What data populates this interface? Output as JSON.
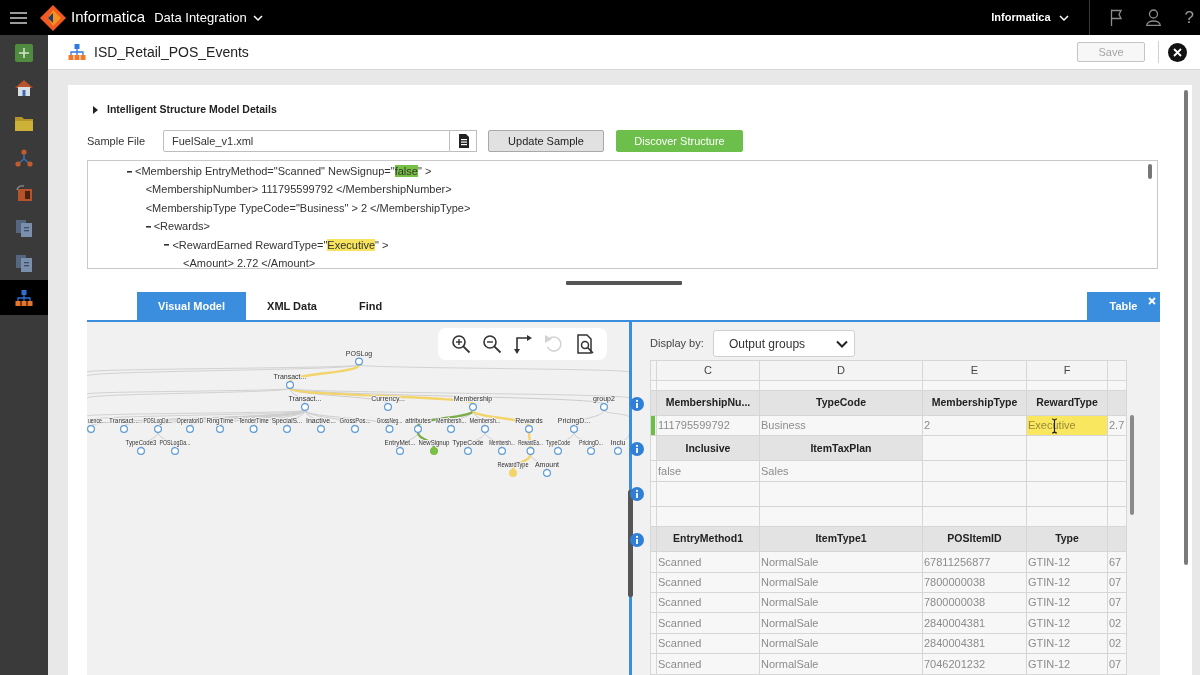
{
  "top_bar": {
    "brand": "Informatica",
    "app": "Data Integration",
    "org": "Informatica",
    "help": "?"
  },
  "sidebar": {
    "items": [
      {
        "kind": "new",
        "selected": false
      },
      {
        "kind": "home",
        "selected": false
      },
      {
        "kind": "folder",
        "selected": false
      },
      {
        "kind": "network",
        "selected": false
      },
      {
        "kind": "package",
        "selected": false
      },
      {
        "kind": "document",
        "selected": false
      },
      {
        "kind": "document",
        "selected": false
      },
      {
        "kind": "structure",
        "selected": true
      }
    ]
  },
  "header": {
    "title": "ISD_Retail_POS_Events",
    "save": {
      "label": "Save",
      "disabled": true
    }
  },
  "details": {
    "label": "Intelligent Structure Model Details",
    "expanded": false
  },
  "sample": {
    "label": "Sample File",
    "value": "FuelSale_v1.xml",
    "buttons": [
      {
        "label": "Update Sample",
        "kind": "secondary"
      },
      {
        "label": "Discover Structure",
        "kind": "primary"
      }
    ]
  },
  "xml": [
    {
      "segments": [
        {
          "text": "<Membership EntryMethod=\"Scanned\" NewSignup=\""
        },
        {
          "text": "false",
          "color": "#76c043"
        },
        {
          "text": "\" >"
        }
      ],
      "expanded": true,
      "children": [
        {
          "segments": [
            {
              "text": "<MembershipNumber> 111795599792 </MembershipNumber>"
            }
          ]
        },
        {
          "segments": [
            {
              "text": "<MembershipType TypeCode=\"Business\" > 2 </MembershipType>"
            }
          ]
        },
        {
          "segments": [
            {
              "text": "<Rewards>"
            }
          ],
          "expanded": true,
          "children": [
            {
              "segments": [
                {
                  "text": "<RewardEarned RewardType=\""
                },
                {
                  "text": "Executive",
                  "color": "#f7e35c"
                },
                {
                  "text": "\" >"
                }
              ],
              "expanded": true,
              "children": [
                {
                  "segments": [
                    {
                      "text": "<Amount> 2.72 </Amount>"
                    }
                  ]
                }
              ]
            }
          ]
        }
      ]
    }
  ],
  "tabs": [
    {
      "label": "Visual Model",
      "selected": true
    },
    {
      "label": "XML Data",
      "selected": false
    },
    {
      "label": "Find",
      "selected": false
    }
  ],
  "side_tab": {
    "label": "Table",
    "selected": true
  },
  "visual_model": {
    "toolbar": [
      {
        "kind": "zoom_in",
        "disabled": false
      },
      {
        "kind": "zoom_out",
        "disabled": false
      },
      {
        "kind": "layout",
        "disabled": false
      },
      {
        "kind": "undo",
        "disabled": true
      },
      {
        "kind": "fit",
        "disabled": false
      }
    ],
    "tree": [
      {
        "label": "POSLog",
        "children": [
          {
            "label": "Transact...",
            "link": {
              "color": "#f2d46b"
            },
            "children": [
              {
                "label": "Transact...",
                "children": [
                  {
                    "label": "uence..."
                  },
                  {
                    "label": "Transact..."
                  },
                  {
                    "label": "POSLogDa...",
                    "children": [
                      {
                        "label": "TypeCode3"
                      },
                      {
                        "label": "POSLogDa..."
                      }
                    ]
                  },
                  {
                    "label": "OperatorID"
                  },
                  {
                    "label": "RingTime"
                  },
                  {
                    "label": "TenderTime"
                  },
                  {
                    "label": "SpecialS..."
                  },
                  {
                    "label": "Inactive..."
                  },
                  {
                    "label": "GrossPos..."
                  },
                  {
                    "label": "GrossNeg..."
                  }
                ]
              },
              {
                "label": "Currency..."
              },
              {
                "label": "Membership",
                "link": {
                  "color": "#f2d46b"
                },
                "children": [
                  {
                    "label": "attributes",
                    "link": {
                      "color": "#79ad4a"
                    },
                    "children": [
                      {
                        "label": "EntryMet..."
                      },
                      {
                        "label": "NewSignup",
                        "link": {
                          "color": "#79ad4a"
                        },
                        "color": "#79c043"
                      }
                    ]
                  },
                  {
                    "label": "Membersh..."
                  },
                  {
                    "label": "Membersh...",
                    "children": [
                      {
                        "label": "TypeCode"
                      },
                      {
                        "label": "Membersh..."
                      }
                    ]
                  },
                  {
                    "label": "Rewards",
                    "link": {
                      "color": "#f2d46b"
                    },
                    "children": [
                      {
                        "label": "RewardEa...",
                        "link": {
                          "color": "#f2d46b"
                        },
                        "children": [
                          {
                            "label": "RewardType",
                            "link": {
                              "color": "#f2d46b"
                            },
                            "color": "#f2d46b"
                          },
                          {
                            "label": "Amount"
                          }
                        ]
                      }
                    ]
                  }
                ]
              },
              {
                "label": "group2",
                "children": [
                  {
                    "label": "PricingD...",
                    "children": [
                      {
                        "label": "TypeCode"
                      },
                      {
                        "label": "PricingD..."
                      }
                    ]
                  }
                ]
              }
            ]
          }
        ]
      },
      {
        "label": "Inclu"
      }
    ]
  },
  "table": {
    "display_by": {
      "label": "Display by:",
      "value": "Output groups"
    },
    "columns": [
      "C",
      "D",
      "E",
      "F"
    ],
    "rows": [
      {
        "kind": "gap"
      },
      {
        "kind": "group",
        "cells": [
          "MembershipNu...",
          "TypeCode",
          "MembershipType",
          "RewardType"
        ]
      },
      {
        "kind": "data",
        "selected": true,
        "cells": [
          "111795599792",
          "Business",
          "2",
          {
            "text": "Executive",
            "color": "#f9e75f",
            "cursor": true
          },
          "2.7"
        ]
      },
      {
        "kind": "group",
        "cells": [
          "Inclusive",
          "ItemTaxPlan"
        ]
      },
      {
        "kind": "data",
        "selected": false,
        "cells": [
          "false",
          "Sales"
        ]
      },
      {
        "kind": "group"
      },
      {
        "kind": "data",
        "selected": false
      },
      {
        "kind": "group",
        "cells": [
          "EntryMethod1",
          "ItemType1",
          "POSItemID",
          "Type"
        ]
      },
      {
        "kind": "data",
        "selected": false,
        "cells": [
          "Scanned",
          "NormalSale",
          "67811256877",
          "GTIN-12",
          "67"
        ]
      },
      {
        "kind": "data",
        "selected": false,
        "cells": [
          "Scanned",
          "NormalSale",
          "7800000038",
          "GTIN-12",
          "07"
        ]
      },
      {
        "kind": "data",
        "selected": false,
        "cells": [
          "Scanned",
          "NormalSale",
          "7800000038",
          "GTIN-12",
          "07"
        ]
      },
      {
        "kind": "data",
        "selected": false,
        "cells": [
          "Scanned",
          "NormalSale",
          "2840004381",
          "GTIN-12",
          "02"
        ]
      },
      {
        "kind": "data",
        "selected": false,
        "cells": [
          "Scanned",
          "NormalSale",
          "2840004381",
          "GTIN-12",
          "02"
        ]
      },
      {
        "kind": "data",
        "selected": false,
        "cells": [
          "Scanned",
          "NormalSale",
          "7046201232",
          "GTIN-12",
          "07"
        ]
      }
    ]
  }
}
